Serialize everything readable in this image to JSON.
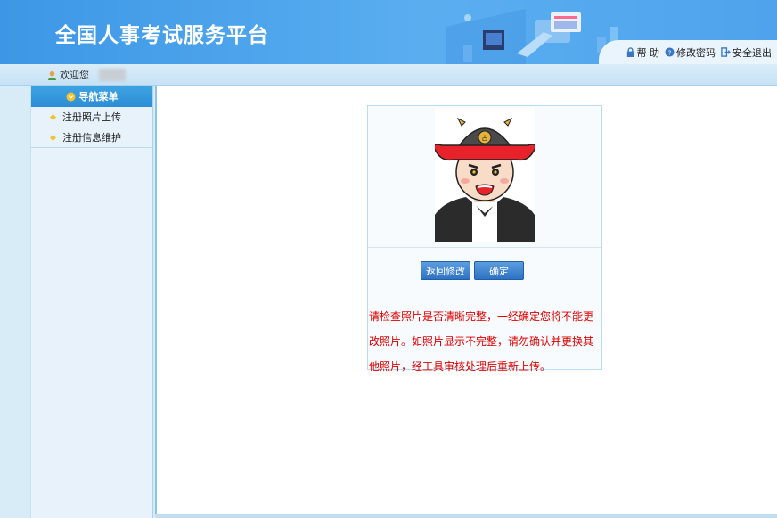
{
  "header": {
    "site_title": "全国人事考试服务平台",
    "links": {
      "help": "帮 助",
      "change_password": "修改密码",
      "logout": "安全退出"
    }
  },
  "welcome": {
    "label": "欢迎您"
  },
  "sidebar": {
    "heading": "导航菜单",
    "items": [
      {
        "label": "注册照片上传"
      },
      {
        "label": "注册信息维护"
      }
    ]
  },
  "main": {
    "buttons": {
      "back": "返回修改",
      "confirm": "确定"
    },
    "notice": "请检查照片是否清晰完整，一经确定您将不能更改照片。如照片显示不完整，请勿确认并更换其他照片，经工具审核处理后重新上传。"
  },
  "colors": {
    "header_blue": "#4ea3ec",
    "notice_red": "#e00000",
    "button_blue": "#2f72c4"
  }
}
